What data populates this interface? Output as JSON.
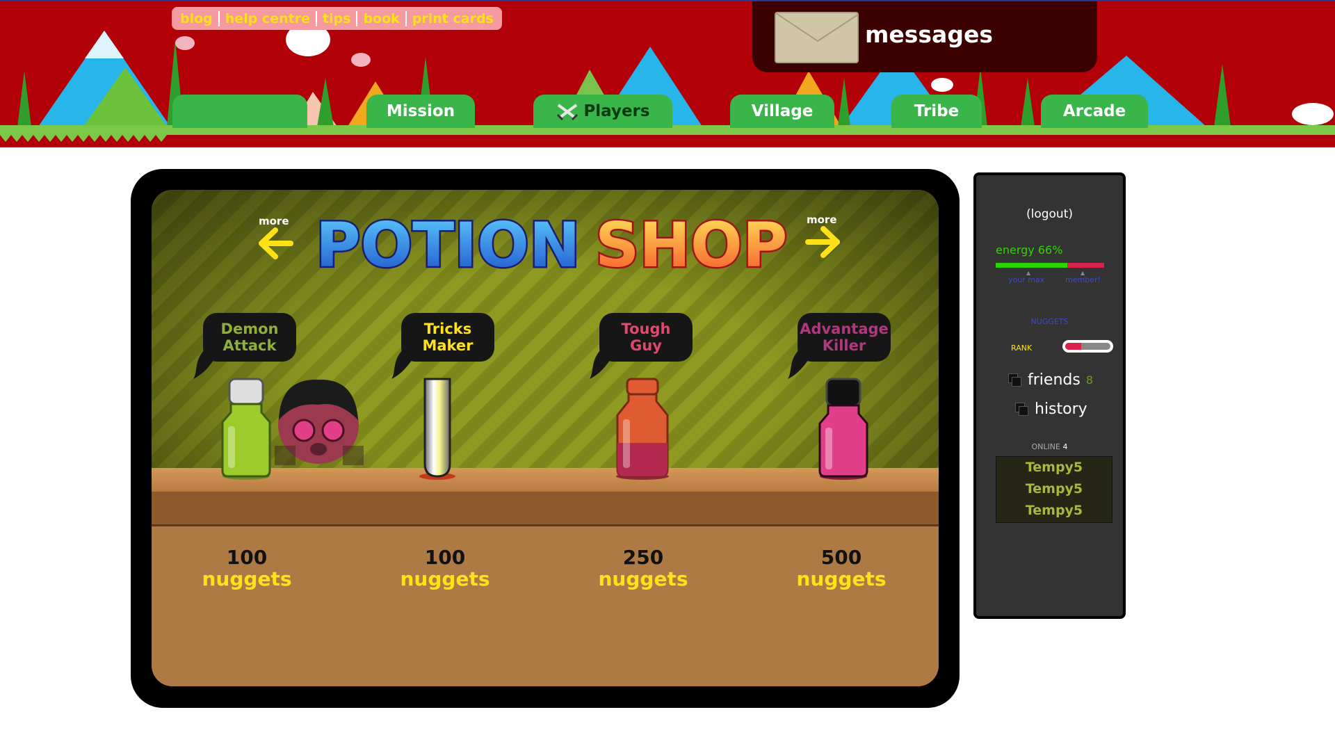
{
  "header": {
    "top_links": [
      "blog",
      "help centre",
      "tips",
      "book",
      "print cards"
    ],
    "messages_label": "messages",
    "tabs": [
      {
        "label": "",
        "icon": ""
      },
      {
        "label": "Mission",
        "icon": ""
      },
      {
        "label": "Players",
        "icon": "crossed-swords-icon",
        "active": true
      },
      {
        "label": "Village",
        "icon": ""
      },
      {
        "label": "Tribe",
        "icon": ""
      },
      {
        "label": "Arcade",
        "icon": ""
      }
    ]
  },
  "shop": {
    "title_part1": "POTION",
    "title_part2": "SHOP",
    "more_left": "more",
    "more_right": "more",
    "potions": [
      {
        "name_line1": "Demon",
        "name_line2": "Attack",
        "name_color": "#8fae3a",
        "price": "100",
        "unit": "nuggets",
        "bottle_color": "#9bcc2c",
        "cap_color": "#dedede"
      },
      {
        "name_line1": "Tricks",
        "name_line2": "Maker",
        "name_color": "#ffe119",
        "price": "100",
        "unit": "nuggets",
        "bottle_color": "#f4f08a",
        "cap_color": "#ffffff"
      },
      {
        "name_line1": "Tough",
        "name_line2": "Guy",
        "name_color": "#e0486c",
        "price": "250",
        "unit": "nuggets",
        "bottle_color": "#e05a32",
        "cap_color": "#e05a32"
      },
      {
        "name_line1": "Advantage",
        "name_line2": "Killer",
        "name_color": "#b2387e",
        "price": "500",
        "unit": "nuggets",
        "bottle_color": "#e23f8a",
        "cap_color": "#111111"
      }
    ]
  },
  "sidebar": {
    "logout": "(logout)",
    "energy_label": "energy 66%",
    "energy_percent": 66,
    "marker_left": "your max",
    "marker_right": "member!",
    "nuggets_label": "NUGGETS",
    "rank_label": "RANK",
    "rank_fraction": 0.35,
    "friends_label": "friends",
    "friends_count": "8",
    "history_label": "history",
    "online_label": "ONLINE",
    "online_count": "4",
    "players": [
      "Tempy5",
      "Tempy5",
      "Tempy5"
    ]
  },
  "colors": {
    "header_red": "#b10007",
    "tab_green": "#3ab54a",
    "link_yellow": "#ffe119",
    "counter_brown": "#ad7944"
  }
}
